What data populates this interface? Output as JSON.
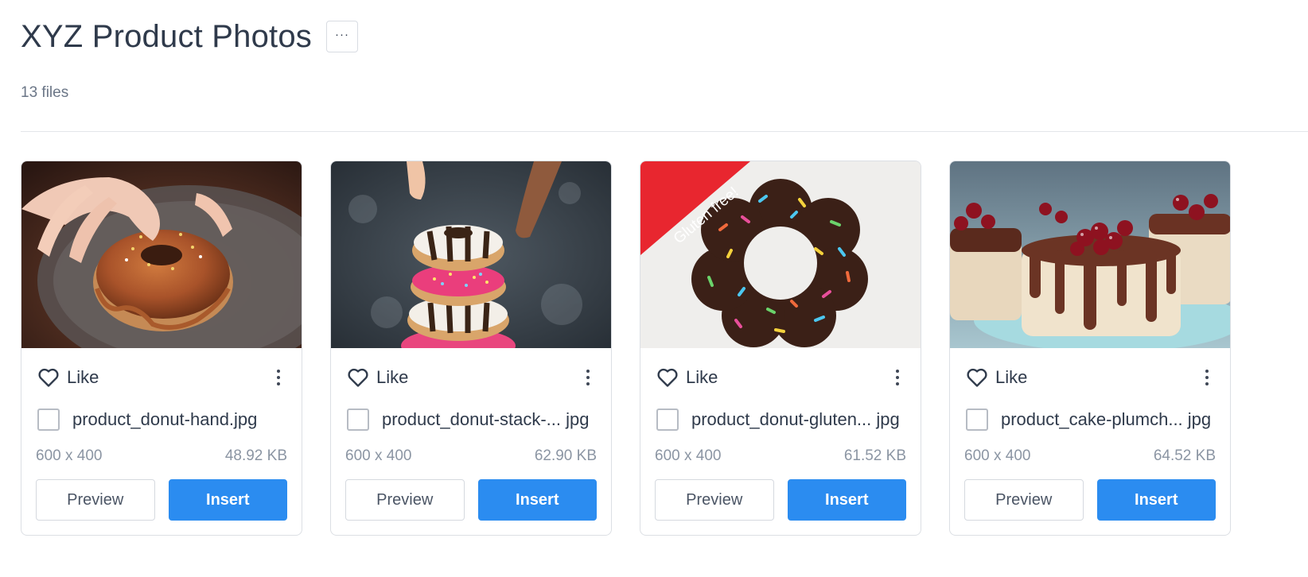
{
  "page": {
    "title": "XYZ Product Photos",
    "more_label": "···",
    "file_count": "13 files"
  },
  "colors": {
    "accent": "#2b8cf0",
    "ribbon": "#e8262f"
  },
  "cards": [
    {
      "like_label": "Like",
      "filename": "product_donut-hand.jpg",
      "dimensions": "600 x 400",
      "size": "48.92 KB",
      "preview_label": "Preview",
      "insert_label": "Insert",
      "image_desc_icon": "donut-hand-photo",
      "ribbon": ""
    },
    {
      "like_label": "Like",
      "filename": "product_donut-stack-... jpg",
      "dimensions": "600 x 400",
      "size": "62.90 KB",
      "preview_label": "Preview",
      "insert_label": "Insert",
      "image_desc_icon": "donut-stack-photo",
      "ribbon": ""
    },
    {
      "like_label": "Like",
      "filename": "product_donut-gluten... jpg",
      "dimensions": "600 x 400",
      "size": "61.52 KB",
      "preview_label": "Preview",
      "insert_label": "Insert",
      "image_desc_icon": "chocolate-donut-photo",
      "ribbon": "Gluten free!"
    },
    {
      "like_label": "Like",
      "filename": "product_cake-plumch... jpg",
      "dimensions": "600 x 400",
      "size": "64.52 KB",
      "preview_label": "Preview",
      "insert_label": "Insert",
      "image_desc_icon": "plum-cake-photo",
      "ribbon": ""
    }
  ]
}
